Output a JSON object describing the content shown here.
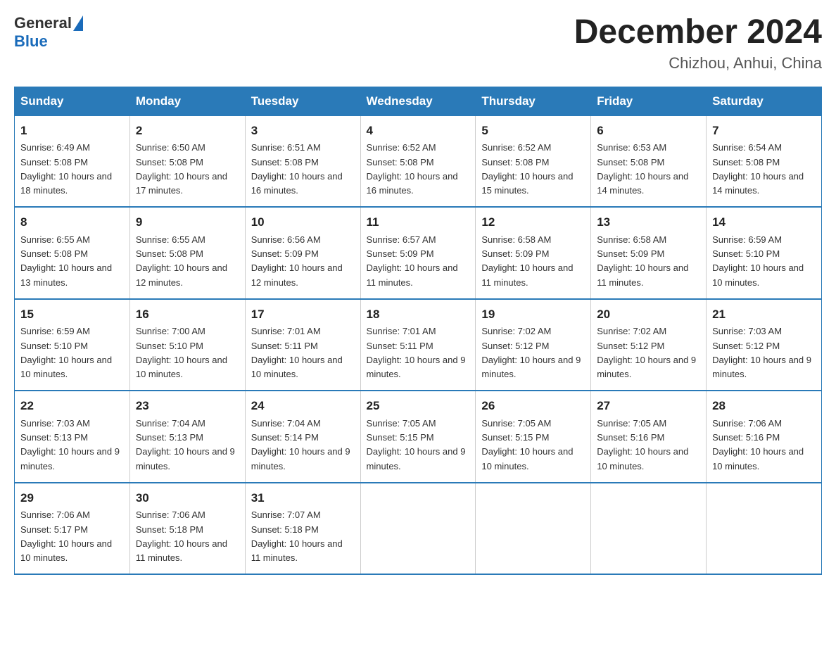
{
  "header": {
    "logo_general": "General",
    "logo_blue": "Blue",
    "title": "December 2024",
    "subtitle": "Chizhou, Anhui, China"
  },
  "days_of_week": [
    "Sunday",
    "Monday",
    "Tuesday",
    "Wednesday",
    "Thursday",
    "Friday",
    "Saturday"
  ],
  "weeks": [
    [
      {
        "num": "1",
        "sunrise": "6:49 AM",
        "sunset": "5:08 PM",
        "daylight": "10 hours and 18 minutes."
      },
      {
        "num": "2",
        "sunrise": "6:50 AM",
        "sunset": "5:08 PM",
        "daylight": "10 hours and 17 minutes."
      },
      {
        "num": "3",
        "sunrise": "6:51 AM",
        "sunset": "5:08 PM",
        "daylight": "10 hours and 16 minutes."
      },
      {
        "num": "4",
        "sunrise": "6:52 AM",
        "sunset": "5:08 PM",
        "daylight": "10 hours and 16 minutes."
      },
      {
        "num": "5",
        "sunrise": "6:52 AM",
        "sunset": "5:08 PM",
        "daylight": "10 hours and 15 minutes."
      },
      {
        "num": "6",
        "sunrise": "6:53 AM",
        "sunset": "5:08 PM",
        "daylight": "10 hours and 14 minutes."
      },
      {
        "num": "7",
        "sunrise": "6:54 AM",
        "sunset": "5:08 PM",
        "daylight": "10 hours and 14 minutes."
      }
    ],
    [
      {
        "num": "8",
        "sunrise": "6:55 AM",
        "sunset": "5:08 PM",
        "daylight": "10 hours and 13 minutes."
      },
      {
        "num": "9",
        "sunrise": "6:55 AM",
        "sunset": "5:08 PM",
        "daylight": "10 hours and 12 minutes."
      },
      {
        "num": "10",
        "sunrise": "6:56 AM",
        "sunset": "5:09 PM",
        "daylight": "10 hours and 12 minutes."
      },
      {
        "num": "11",
        "sunrise": "6:57 AM",
        "sunset": "5:09 PM",
        "daylight": "10 hours and 11 minutes."
      },
      {
        "num": "12",
        "sunrise": "6:58 AM",
        "sunset": "5:09 PM",
        "daylight": "10 hours and 11 minutes."
      },
      {
        "num": "13",
        "sunrise": "6:58 AM",
        "sunset": "5:09 PM",
        "daylight": "10 hours and 11 minutes."
      },
      {
        "num": "14",
        "sunrise": "6:59 AM",
        "sunset": "5:10 PM",
        "daylight": "10 hours and 10 minutes."
      }
    ],
    [
      {
        "num": "15",
        "sunrise": "6:59 AM",
        "sunset": "5:10 PM",
        "daylight": "10 hours and 10 minutes."
      },
      {
        "num": "16",
        "sunrise": "7:00 AM",
        "sunset": "5:10 PM",
        "daylight": "10 hours and 10 minutes."
      },
      {
        "num": "17",
        "sunrise": "7:01 AM",
        "sunset": "5:11 PM",
        "daylight": "10 hours and 10 minutes."
      },
      {
        "num": "18",
        "sunrise": "7:01 AM",
        "sunset": "5:11 PM",
        "daylight": "10 hours and 9 minutes."
      },
      {
        "num": "19",
        "sunrise": "7:02 AM",
        "sunset": "5:12 PM",
        "daylight": "10 hours and 9 minutes."
      },
      {
        "num": "20",
        "sunrise": "7:02 AM",
        "sunset": "5:12 PM",
        "daylight": "10 hours and 9 minutes."
      },
      {
        "num": "21",
        "sunrise": "7:03 AM",
        "sunset": "5:12 PM",
        "daylight": "10 hours and 9 minutes."
      }
    ],
    [
      {
        "num": "22",
        "sunrise": "7:03 AM",
        "sunset": "5:13 PM",
        "daylight": "10 hours and 9 minutes."
      },
      {
        "num": "23",
        "sunrise": "7:04 AM",
        "sunset": "5:13 PM",
        "daylight": "10 hours and 9 minutes."
      },
      {
        "num": "24",
        "sunrise": "7:04 AM",
        "sunset": "5:14 PM",
        "daylight": "10 hours and 9 minutes."
      },
      {
        "num": "25",
        "sunrise": "7:05 AM",
        "sunset": "5:15 PM",
        "daylight": "10 hours and 9 minutes."
      },
      {
        "num": "26",
        "sunrise": "7:05 AM",
        "sunset": "5:15 PM",
        "daylight": "10 hours and 10 minutes."
      },
      {
        "num": "27",
        "sunrise": "7:05 AM",
        "sunset": "5:16 PM",
        "daylight": "10 hours and 10 minutes."
      },
      {
        "num": "28",
        "sunrise": "7:06 AM",
        "sunset": "5:16 PM",
        "daylight": "10 hours and 10 minutes."
      }
    ],
    [
      {
        "num": "29",
        "sunrise": "7:06 AM",
        "sunset": "5:17 PM",
        "daylight": "10 hours and 10 minutes."
      },
      {
        "num": "30",
        "sunrise": "7:06 AM",
        "sunset": "5:18 PM",
        "daylight": "10 hours and 11 minutes."
      },
      {
        "num": "31",
        "sunrise": "7:07 AM",
        "sunset": "5:18 PM",
        "daylight": "10 hours and 11 minutes."
      },
      null,
      null,
      null,
      null
    ]
  ]
}
